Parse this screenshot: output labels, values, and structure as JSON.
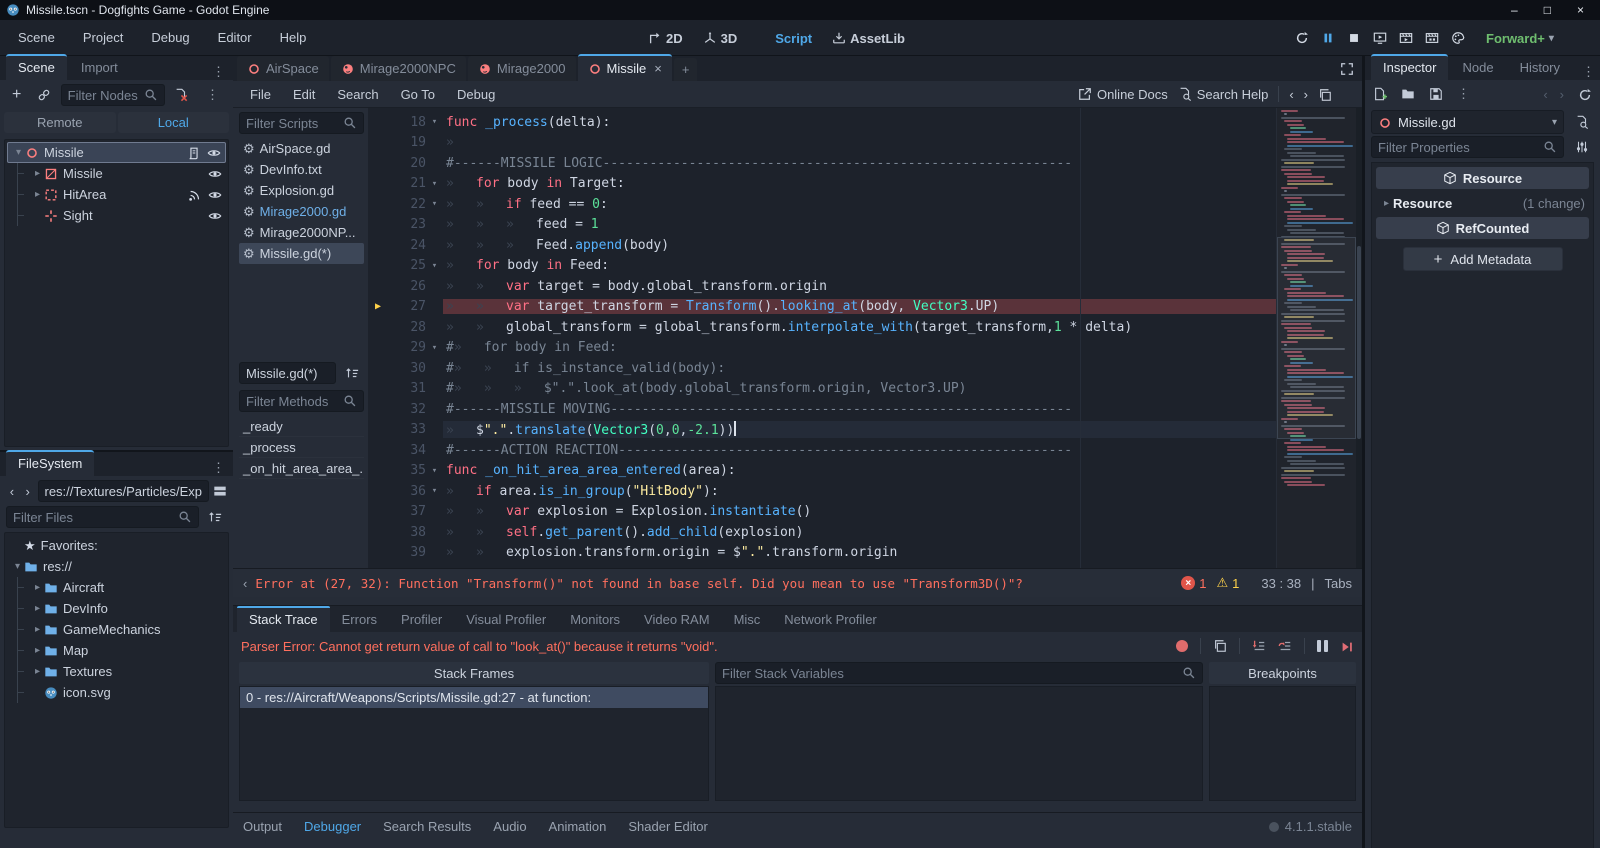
{
  "colors": {
    "accent": "#4fa8e8",
    "error": "#ff6f5e",
    "warning": "#ffd24a",
    "node_red": "#fc7f7f",
    "green": "#6fbe6f",
    "keyword": "#ff7085",
    "function": "#57b3ff",
    "type": "#42ffc2",
    "string": "#ffeda1",
    "number": "#5ce29a",
    "comment": "#798594",
    "exec_line_bg": "#5a333a",
    "folder_blue": "#6fb0e8"
  },
  "window": {
    "title": "Missile.tscn - Dogfights Game - Godot Engine",
    "controls": [
      "minimize",
      "maximize",
      "close"
    ]
  },
  "menubar": {
    "menus": [
      "Scene",
      "Project",
      "Debug",
      "Editor",
      "Help"
    ],
    "modes": [
      {
        "label": "2D",
        "icon": "2d"
      },
      {
        "label": "3D",
        "icon": "3d"
      },
      {
        "label": "Script",
        "icon": "script",
        "active": true
      },
      {
        "label": "AssetLib",
        "icon": "download"
      }
    ],
    "run_controls": [
      {
        "name": "restart",
        "icon": "reload"
      },
      {
        "name": "pause",
        "icon": "pause",
        "active": true
      },
      {
        "name": "stop",
        "icon": "stop"
      },
      {
        "name": "play-remote",
        "icon": "monitor-play"
      },
      {
        "name": "play-scene",
        "icon": "clapper-play"
      },
      {
        "name": "play-custom-scene",
        "icon": "clapper-grid"
      },
      {
        "name": "movie-maker",
        "icon": "palette"
      }
    ],
    "profile": "Forward+"
  },
  "scene_dock": {
    "tabs": [
      {
        "label": "Scene",
        "active": true
      },
      {
        "label": "Import"
      }
    ],
    "filter_placeholder": "Filter Nodes",
    "remote_label": "Remote",
    "local_label": "Local",
    "nodes": [
      {
        "name": "Missile",
        "icon": "ring",
        "expand": "down",
        "selected": true,
        "script": true,
        "eye": true,
        "indent": 0
      },
      {
        "name": "Missile",
        "icon": "mesh",
        "expand": "right",
        "eye": true,
        "indent": 1
      },
      {
        "name": "HitArea",
        "icon": "collision",
        "expand": "right",
        "signal": true,
        "eye": true,
        "indent": 1
      },
      {
        "name": "Sight",
        "icon": "position",
        "eye": true,
        "indent": 1
      }
    ]
  },
  "filesystem": {
    "title": "FileSystem",
    "path": "res://Textures/Particles/Exp",
    "filter_placeholder": "Filter Files",
    "items": [
      {
        "label": "Favorites:",
        "icon": "star",
        "indent": 0
      },
      {
        "label": "res://",
        "icon": "folder",
        "expand": "down",
        "indent": 0
      },
      {
        "label": "Aircraft",
        "icon": "folder",
        "expand": "right",
        "indent": 1
      },
      {
        "label": "DevInfo",
        "icon": "folder",
        "expand": "right",
        "indent": 1
      },
      {
        "label": "GameMechanics",
        "icon": "folder",
        "expand": "right",
        "indent": 1
      },
      {
        "label": "Map",
        "icon": "folder",
        "expand": "right",
        "indent": 1
      },
      {
        "label": "Textures",
        "icon": "folder",
        "expand": "right",
        "indent": 1
      },
      {
        "label": "icon.svg",
        "icon": "godot",
        "indent": 1
      }
    ]
  },
  "script_editor": {
    "scene_tabs": [
      {
        "label": "AirSpace",
        "icon": "ring"
      },
      {
        "label": "Mirage2000NPC",
        "icon": "rigid"
      },
      {
        "label": "Mirage2000",
        "icon": "rigid"
      },
      {
        "label": "Missile",
        "icon": "ring",
        "active": true,
        "closable": true
      }
    ],
    "menus": [
      "File",
      "Edit",
      "Search",
      "Go To",
      "Debug"
    ],
    "online_docs": "Online Docs",
    "search_help": "Search Help",
    "filter_scripts_placeholder": "Filter Scripts",
    "scripts": [
      {
        "label": "AirSpace.gd",
        "icon": "gear"
      },
      {
        "label": "DevInfo.txt",
        "icon": "textfile"
      },
      {
        "label": "Explosion.gd",
        "icon": "gear"
      },
      {
        "label": "Mirage2000.gd",
        "icon": "gear",
        "used": true
      },
      {
        "label": "Mirage2000NP...",
        "icon": "gear"
      },
      {
        "label": "Missile.gd(*)",
        "icon": "gear",
        "selected": true
      }
    ],
    "current_script": "Missile.gd(*)",
    "filter_methods_placeholder": "Filter Methods",
    "methods": [
      "_ready",
      "_process",
      "_on_hit_area_area_..."
    ],
    "code": {
      "lines": [
        {
          "n": "18",
          "fold": true,
          "seg": [
            {
              "c": "kw",
              "t": "func"
            },
            {
              "c": "tx",
              "t": " "
            },
            {
              "c": "fn",
              "t": "_process"
            },
            {
              "c": "tx",
              "t": "(delta):"
            }
          ]
        },
        {
          "n": "19",
          "seg": [
            {
              "c": "tab"
            }
          ]
        },
        {
          "n": "20",
          "seg": [
            {
              "c": "cm",
              "t": "#------MISSILE LOGIC------------------------------------------------------------"
            }
          ]
        },
        {
          "n": "21",
          "fold": true,
          "seg": [
            {
              "c": "tab"
            },
            {
              "c": "kw",
              "t": "for"
            },
            {
              "c": "tx",
              "t": " body "
            },
            {
              "c": "kw",
              "t": "in"
            },
            {
              "c": "tx",
              "t": " Target:"
            }
          ]
        },
        {
          "n": "22",
          "fold": true,
          "seg": [
            {
              "c": "tab"
            },
            {
              "c": "tab"
            },
            {
              "c": "kw",
              "t": "if"
            },
            {
              "c": "tx",
              "t": " feed == "
            },
            {
              "c": "num",
              "t": "0"
            },
            {
              "c": "tx",
              "t": ":"
            }
          ]
        },
        {
          "n": "23",
          "seg": [
            {
              "c": "tab"
            },
            {
              "c": "tab"
            },
            {
              "c": "tab"
            },
            {
              "c": "tx",
              "t": "feed = "
            },
            {
              "c": "num",
              "t": "1"
            }
          ]
        },
        {
          "n": "24",
          "seg": [
            {
              "c": "tab"
            },
            {
              "c": "tab"
            },
            {
              "c": "tab"
            },
            {
              "c": "tx",
              "t": "Feed."
            },
            {
              "c": "fn",
              "t": "append"
            },
            {
              "c": "tx",
              "t": "(body)"
            }
          ]
        },
        {
          "n": "25",
          "fold": true,
          "seg": [
            {
              "c": "tab"
            },
            {
              "c": "kw",
              "t": "for"
            },
            {
              "c": "tx",
              "t": " body "
            },
            {
              "c": "kw",
              "t": "in"
            },
            {
              "c": "tx",
              "t": " Feed:"
            }
          ]
        },
        {
          "n": "26",
          "seg": [
            {
              "c": "tab"
            },
            {
              "c": "tab"
            },
            {
              "c": "kw",
              "t": "var"
            },
            {
              "c": "tx",
              "t": " target = body.global_transform.origin"
            }
          ]
        },
        {
          "n": "27",
          "exec": true,
          "seg": [
            {
              "c": "tab"
            },
            {
              "c": "tab"
            },
            {
              "c": "kw",
              "t": "var"
            },
            {
              "c": "tx",
              "t": " target_transform = "
            },
            {
              "c": "fn",
              "t": "Transform"
            },
            {
              "c": "tx",
              "t": "()."
            },
            {
              "c": "fn",
              "t": "looking_at"
            },
            {
              "c": "tx",
              "t": "(body, "
            },
            {
              "c": "typ",
              "t": "Vector3"
            },
            {
              "c": "tx",
              "t": ".UP)"
            }
          ]
        },
        {
          "n": "28",
          "seg": [
            {
              "c": "tab"
            },
            {
              "c": "tab"
            },
            {
              "c": "tx",
              "t": "global_transform = global_transform."
            },
            {
              "c": "fn",
              "t": "interpolate_with"
            },
            {
              "c": "tx",
              "t": "(target_transform,"
            },
            {
              "c": "num",
              "t": "1"
            },
            {
              "c": "tx",
              "t": " * delta)"
            }
          ]
        },
        {
          "n": "29",
          "fold": true,
          "seg": [
            {
              "c": "cm",
              "t": "#"
            },
            {
              "c": "tab"
            },
            {
              "c": "cm",
              "t": "for body in Feed:"
            }
          ]
        },
        {
          "n": "30",
          "seg": [
            {
              "c": "cm",
              "t": "#"
            },
            {
              "c": "tab"
            },
            {
              "c": "tab"
            },
            {
              "c": "cm",
              "t": "if is_instance_valid(body):"
            }
          ]
        },
        {
          "n": "31",
          "seg": [
            {
              "c": "cm",
              "t": "#"
            },
            {
              "c": "tab"
            },
            {
              "c": "tab"
            },
            {
              "c": "tab"
            },
            {
              "c": "cm",
              "t": "$\".\".look_at(body.global_transform.origin, Vector3.UP)"
            }
          ]
        },
        {
          "n": "32",
          "seg": [
            {
              "c": "cm",
              "t": "#------MISSILE MOVING-----------------------------------------------------------"
            }
          ]
        },
        {
          "n": "33",
          "cur": true,
          "seg": [
            {
              "c": "tab"
            },
            {
              "c": "tx",
              "t": "$"
            },
            {
              "c": "str",
              "t": "\".\""
            },
            {
              "c": "tx",
              "t": "."
            },
            {
              "c": "fn",
              "t": "translate"
            },
            {
              "c": "tx",
              "t": "("
            },
            {
              "c": "typ",
              "t": "Vector3"
            },
            {
              "c": "tx",
              "t": "("
            },
            {
              "c": "num",
              "t": "0"
            },
            {
              "c": "tx",
              "t": ","
            },
            {
              "c": "num",
              "t": "0"
            },
            {
              "c": "tx",
              "t": ","
            },
            {
              "c": "num",
              "t": "-2.1"
            },
            {
              "c": "tx",
              "t": "))"
            },
            {
              "c": "caret"
            }
          ]
        },
        {
          "n": "34",
          "seg": [
            {
              "c": "cm",
              "t": "#------ACTION REACTION----------------------------------------------------------"
            }
          ]
        },
        {
          "n": "35",
          "fold": true,
          "seg": [
            {
              "c": "kw",
              "t": "func"
            },
            {
              "c": "tx",
              "t": " "
            },
            {
              "c": "fn",
              "t": "_on_hit_area_area_entered"
            },
            {
              "c": "tx",
              "t": "(area):"
            }
          ]
        },
        {
          "n": "36",
          "fold": true,
          "seg": [
            {
              "c": "tab"
            },
            {
              "c": "kw",
              "t": "if"
            },
            {
              "c": "tx",
              "t": " area."
            },
            {
              "c": "fn",
              "t": "is_in_group"
            },
            {
              "c": "tx",
              "t": "("
            },
            {
              "c": "str",
              "t": "\"HitBody\""
            },
            {
              "c": "tx",
              "t": "):"
            }
          ]
        },
        {
          "n": "37",
          "seg": [
            {
              "c": "tab"
            },
            {
              "c": "tab"
            },
            {
              "c": "kw",
              "t": "var"
            },
            {
              "c": "tx",
              "t": " explosion = Explosion."
            },
            {
              "c": "fn",
              "t": "instantiate"
            },
            {
              "c": "tx",
              "t": "()"
            }
          ]
        },
        {
          "n": "38",
          "seg": [
            {
              "c": "tab"
            },
            {
              "c": "tab"
            },
            {
              "c": "kw",
              "t": "self"
            },
            {
              "c": "tx",
              "t": "."
            },
            {
              "c": "fn",
              "t": "get_parent"
            },
            {
              "c": "tx",
              "t": "()."
            },
            {
              "c": "fn",
              "t": "add_child"
            },
            {
              "c": "tx",
              "t": "(explosion)"
            }
          ]
        },
        {
          "n": "39",
          "seg": [
            {
              "c": "tab"
            },
            {
              "c": "tab"
            },
            {
              "c": "tx",
              "t": "explosion.transform.origin = $"
            },
            {
              "c": "str",
              "t": "\".\""
            },
            {
              "c": "tx",
              "t": ".transform.origin"
            }
          ]
        }
      ]
    },
    "status": {
      "error_text": "Error at (27, 32): Function \"Transform()\" not found in base self. Did you mean to use \"Transform3D()\"?",
      "error_count": "1",
      "warning_count": "1",
      "line": "33",
      "col": "38",
      "indent_type": "Tabs"
    }
  },
  "debugger": {
    "tabs": [
      {
        "label": "Stack Trace",
        "active": true
      },
      {
        "label": "Errors"
      },
      {
        "label": "Profiler"
      },
      {
        "label": "Visual Profiler"
      },
      {
        "label": "Monitors"
      },
      {
        "label": "Video RAM"
      },
      {
        "label": "Misc"
      },
      {
        "label": "Network Profiler"
      }
    ],
    "parser_error": "Parser Error: Cannot get return value of call to \"look_at()\" because it returns \"void\".",
    "stack_frames_title": "Stack Frames",
    "frame": "0 - res://Aircraft/Weapons/Scripts/Missile.gd:27 - at function:",
    "filter_placeholder": "Filter Stack Variables",
    "breakpoints_title": "Breakpoints"
  },
  "bottom_bar": {
    "items": [
      {
        "label": "Output"
      },
      {
        "label": "Debugger",
        "active": true
      },
      {
        "label": "Search Results"
      },
      {
        "label": "Audio"
      },
      {
        "label": "Animation"
      },
      {
        "label": "Shader Editor"
      }
    ],
    "version": "4.1.1.stable"
  },
  "inspector": {
    "tabs": [
      {
        "label": "Inspector",
        "active": true
      },
      {
        "label": "Node"
      },
      {
        "label": "History"
      }
    ],
    "object_name": "Missile.gd",
    "filter_placeholder": "Filter Properties",
    "resource_header": "Resource",
    "resource_row": {
      "label": "Resource",
      "badge": "(1 change)"
    },
    "refcounted_header": "RefCounted",
    "add_metadata_label": "Add Metadata"
  }
}
